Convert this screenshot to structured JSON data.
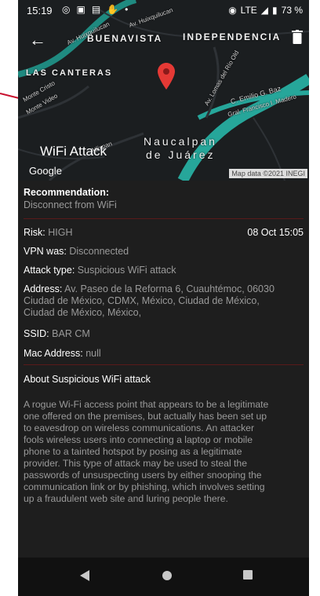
{
  "status_bar": {
    "time": "15:19",
    "network": "LTE",
    "battery": "73 %"
  },
  "map": {
    "labels": {
      "buenavista": "BUENAVISTA",
      "independencia": "INDEPENDENCIA",
      "las_canteras": "LAS CANTERAS",
      "naucalpan": "Naucalpan",
      "de_juarez": "de Juárez",
      "street_huixquilucan_1": "Av. Huixquilucan",
      "street_huixquilucan_2": "Av. Huixquilucan",
      "street_monte_cristo": "Monte Cristo",
      "street_monte_video": "Monte Video",
      "street_lomas_rio": "Av. Lomas del Río Old",
      "street_emilio": "C. Emilio G. Baz",
      "street_francisco": "Gral. Francisco I. Madero",
      "street_atizapan": "Atlixpan"
    },
    "title": "WiFi Attack",
    "provider": "Google",
    "attribution": "Map data ©2021 INEGI",
    "accent_color": "#26a69a",
    "pin_color": "#e53935"
  },
  "details": {
    "recommendation_label": "Recommendation:",
    "recommendation_value": "Disconnect from WiFi",
    "risk_label": "Risk:",
    "risk_value": "HIGH",
    "date": "08 Oct 15:05",
    "vpn_label": "VPN was:",
    "vpn_value": "Disconnected",
    "attack_label": "Attack type:",
    "attack_value": "Suspicious WiFi attack",
    "address_label": "Address:",
    "address_value_1": "Av. Paseo de la Reforma 6, Cuauhtémoc, 06030",
    "address_value_2": "Ciudad de México, CDMX, México, Ciudad de México,",
    "address_value_3": "Ciudad de México, México,",
    "ssid_label": "SSID:",
    "ssid_value": "BAR CM",
    "mac_label": "Mac Address:",
    "mac_value": "null"
  },
  "about": {
    "title": "About Suspicious WiFi attack",
    "lines": [
      "A rogue Wi-Fi access point that appears to be a legitimate",
      "one offered on the premises, but actually has been set up",
      "to eavesdrop on wireless communications. An attacker",
      "fools wireless users into connecting a laptop or mobile",
      "phone to a tainted hotspot by posing as a legitimate",
      "provider. This type of attack may be used to steal the",
      "passwords of unsuspecting users by either snooping the",
      "communication link or by phishing, which involves setting",
      "up a fraudulent web site and luring people there."
    ]
  },
  "navbar": {
    "back_icon": "triangle-back-icon",
    "home_icon": "circle-home-icon",
    "recents_icon": "square-recents-icon"
  }
}
